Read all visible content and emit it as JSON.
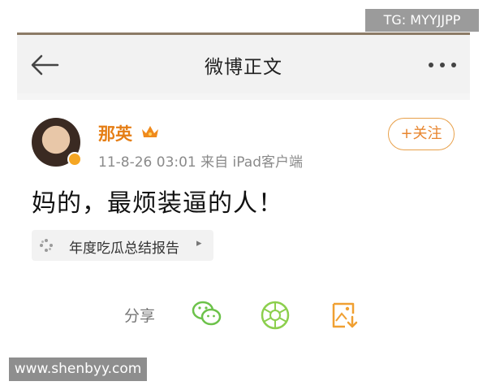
{
  "watermark_top": "TG: MYYJJPP",
  "watermark_bottom": "www.shenbyy.com",
  "navbar": {
    "back_icon": "back-arrow-icon",
    "title": "微博正文",
    "more_icon": "more-dots-icon"
  },
  "post": {
    "author": {
      "name": "那英",
      "avatar": "avatar",
      "member_icon": "crown-icon",
      "verified_icon": "verified-badge-icon"
    },
    "time": "11-8-26 03:01",
    "source": "来自 iPad客户端",
    "follow_label": "+关注",
    "text": "妈的，最烦装逼的人！",
    "topic": {
      "icon": "sparkle-icon",
      "label": "年度吃瓜总结报告",
      "chevron": "▸"
    }
  },
  "share": {
    "label": "分享",
    "targets": [
      "wechat-icon",
      "moments-icon",
      "save-image-icon"
    ]
  },
  "colors": {
    "accent_orange": "#e8862f",
    "name_orange": "#e57e15",
    "wechat_green": "#6cc24a",
    "moments_green": "#8ccf4d",
    "save_orange": "#f0a032"
  }
}
